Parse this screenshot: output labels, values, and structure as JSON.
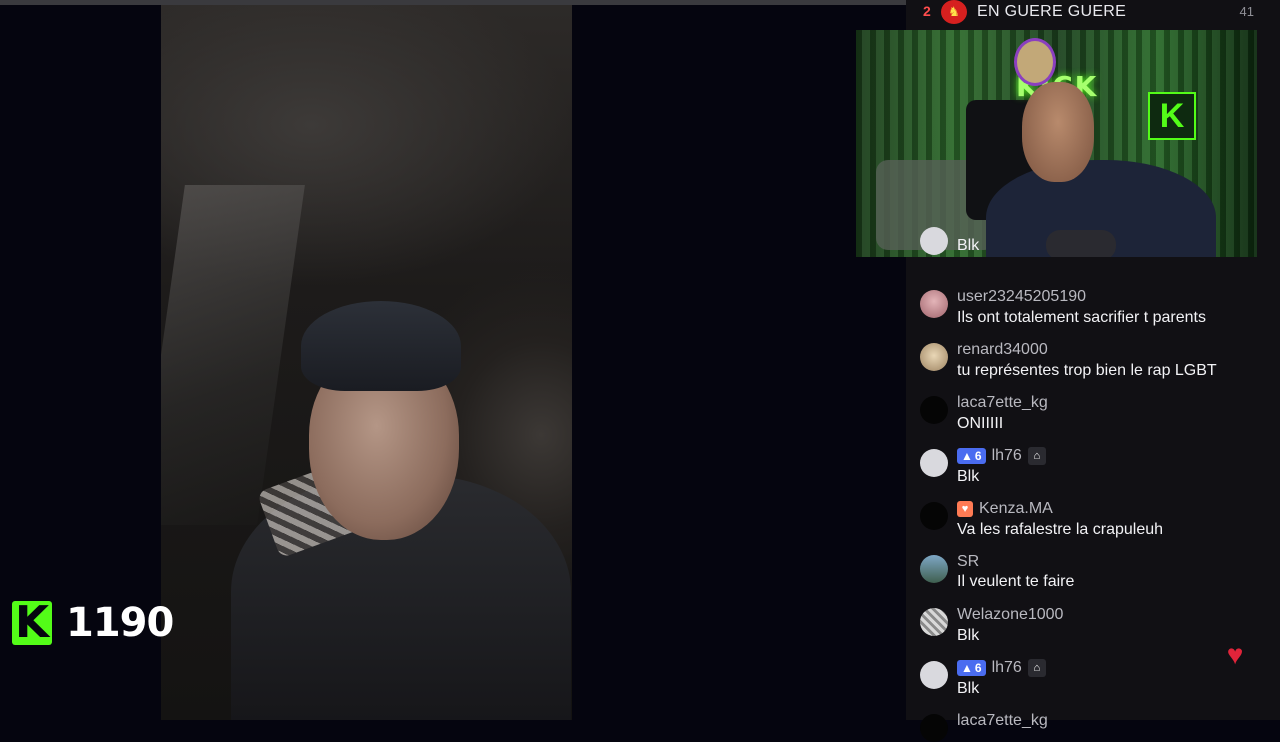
{
  "chat_header": {
    "rank": "2",
    "name": "EN GUERE GUERE",
    "count": "41"
  },
  "stream_overlay": {
    "viewer_count": "1190",
    "logo_letter": "K"
  },
  "pip": {
    "neon_sign": "KICK",
    "wall_logo": "K"
  },
  "messages": [
    {
      "username": "",
      "text": "Blk"
    },
    {
      "username": "user23245205190",
      "text": "Ils ont totalement sacrifier t parents"
    },
    {
      "username": "renard34000",
      "text": "tu représentes trop bien le rap LGBT"
    },
    {
      "username": "laca7ette_kg",
      "text": "ONIIIII"
    },
    {
      "username": "lh76",
      "badge": "6",
      "text": "Blk"
    },
    {
      "username": "Kenza.MA",
      "text": "Va les rafalestre la crapuleuh"
    },
    {
      "username": "SR",
      "text": "Il veulent te faire"
    },
    {
      "username": "Welazone1000",
      "text": "Blk"
    },
    {
      "username": "lh76",
      "badge": "6",
      "text": "Blk"
    },
    {
      "username": "laca7ette_kg",
      "text": ""
    }
  ],
  "colors": {
    "accent": "#53fc18",
    "chat_bg": "#111014",
    "sub_badge": "#4a6cf0",
    "heart": "#e0243a"
  },
  "icons": {
    "sub_badge_icon": "triangle-icon",
    "gift_icon": "gift-icon",
    "vip_icon": "heart-badge-icon",
    "reaction": "heart-icon"
  }
}
